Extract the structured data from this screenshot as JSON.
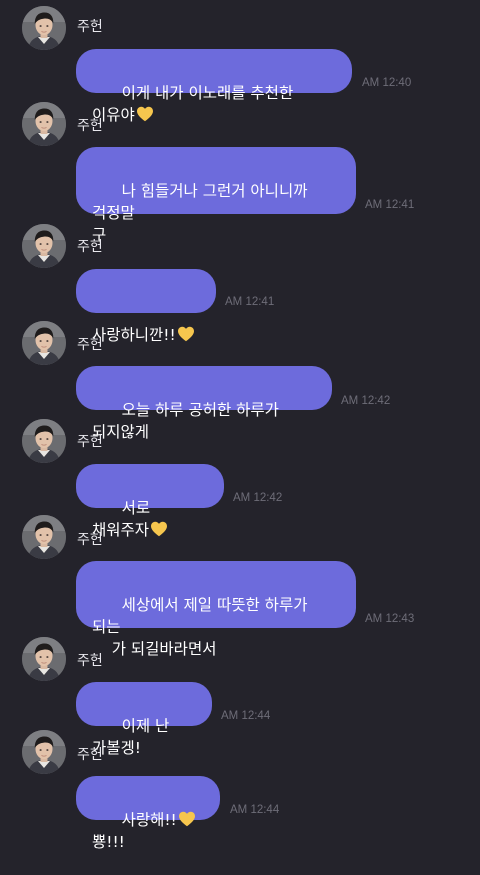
{
  "contact": {
    "name": "주헌"
  },
  "messages": [
    {
      "text": "이게 내가 이노래를 추천한 이유야",
      "heart_after": true,
      "suffix": "",
      "time": "AM 12:40"
    },
    {
      "text": "나 힘들거나 그런거 아니니까 걱정말\n구",
      "heart_after": false,
      "suffix": "",
      "time": "AM 12:41"
    },
    {
      "text": "사랑하니깐!!",
      "heart_after": true,
      "suffix": "",
      "time": "AM 12:41"
    },
    {
      "text": "오늘 하루 공허한 하루가 되지않게",
      "heart_after": false,
      "suffix": "",
      "time": "AM 12:42"
    },
    {
      "text": "서로 채워주자",
      "heart_after": true,
      "suffix": "",
      "time": "AM 12:42"
    },
    {
      "text": "세상에서 제일 따뜻한 하루가 되는\n    가 되길바라면서",
      "heart_after": false,
      "suffix": "",
      "time": "AM 12:43"
    },
    {
      "text": "이제 난 가볼겡!",
      "heart_after": false,
      "suffix": "",
      "time": "AM 12:44"
    },
    {
      "text": "사랑해!!",
      "heart_after": true,
      "suffix": " 뿅!!!",
      "time": "AM 12:44"
    }
  ],
  "colors": {
    "background": "#24232b",
    "bubble": "#6d6bdc",
    "heart": "#f6c64e",
    "timestamp": "#6e6d78"
  },
  "icons": {
    "avatar": "person-avatar-icon",
    "heart": "yellow-heart-icon"
  }
}
